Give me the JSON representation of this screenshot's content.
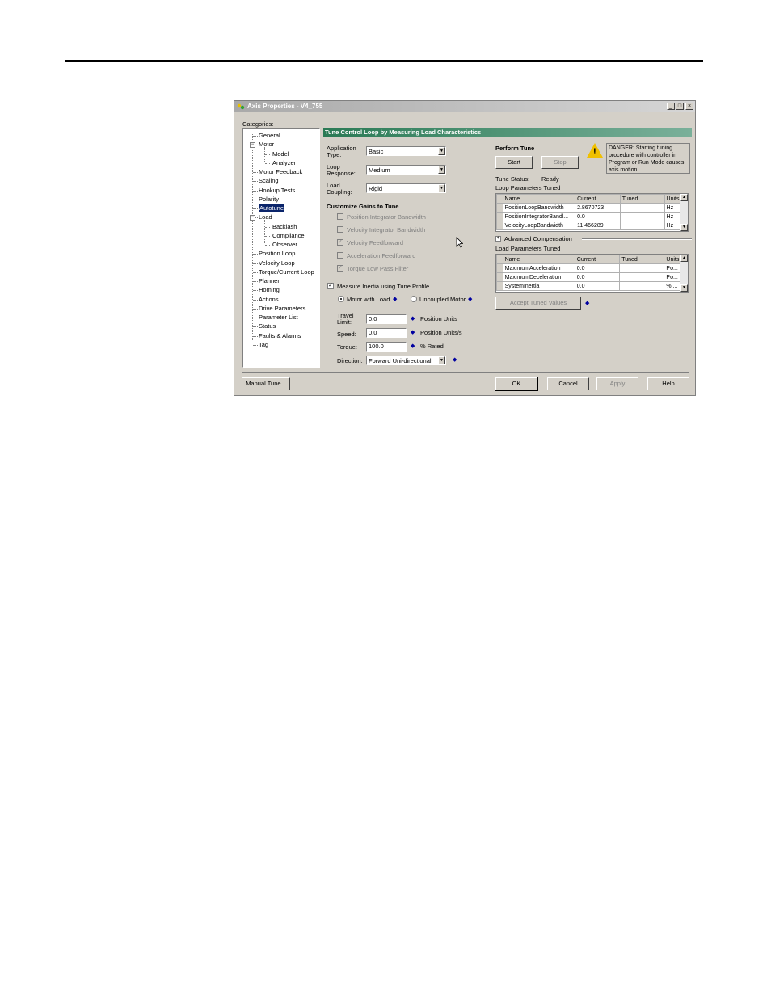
{
  "window": {
    "title": "Axis Properties - V4_755",
    "categories_label": "Categories:"
  },
  "tree": {
    "items": [
      {
        "label": "General",
        "level": 1
      },
      {
        "label": "Motor",
        "level": 1,
        "expander": "−"
      },
      {
        "label": "Model",
        "level": 2
      },
      {
        "label": "Analyzer",
        "level": 2
      },
      {
        "label": "Motor Feedback",
        "level": 1
      },
      {
        "label": "Scaling",
        "level": 1
      },
      {
        "label": "Hookup Tests",
        "level": 1
      },
      {
        "label": "Polarity",
        "level": 1
      },
      {
        "label": "Autotune",
        "level": 1,
        "selected": true
      },
      {
        "label": "Load",
        "level": 1,
        "expander": "−"
      },
      {
        "label": "Backlash",
        "level": 2
      },
      {
        "label": "Compliance",
        "level": 2
      },
      {
        "label": "Observer",
        "level": 2
      },
      {
        "label": "Position Loop",
        "level": 1
      },
      {
        "label": "Velocity Loop",
        "level": 1
      },
      {
        "label": "Torque/Current Loop",
        "level": 1
      },
      {
        "label": "Planner",
        "level": 1
      },
      {
        "label": "Homing",
        "level": 1
      },
      {
        "label": "Actions",
        "level": 1
      },
      {
        "label": "Drive Parameters",
        "level": 1
      },
      {
        "label": "Parameter List",
        "level": 1
      },
      {
        "label": "Status",
        "level": 1
      },
      {
        "label": "Faults & Alarms",
        "level": 1
      },
      {
        "label": "Tag",
        "level": 1
      }
    ]
  },
  "section_title": "Tune Control Loop by Measuring Load Characteristics",
  "left": {
    "application_type_label": "Application Type:",
    "application_type_value": "Basic",
    "loop_response_label": "Loop Response:",
    "loop_response_value": "Medium",
    "load_coupling_label": "Load Coupling:",
    "load_coupling_value": "Rigid",
    "customize_title": "Customize Gains to Tune",
    "gains": [
      {
        "label": "Position Integrator Bandwidth",
        "checked": false
      },
      {
        "label": "Velocity Integrator Bandwidth",
        "checked": false
      },
      {
        "label": "Velocity Feedforward",
        "checked": true
      },
      {
        "label": "Acceleration Feedforward",
        "checked": false
      },
      {
        "label": "Torque Low Pass Filter",
        "checked": true
      }
    ],
    "measure_inertia_label": "Measure Inertia using Tune Profile",
    "motor_with_load_label": "Motor with Load",
    "uncoupled_motor_label": "Uncoupled Motor",
    "travel_limit_label": "Travel Limit:",
    "travel_limit_value": "0.0",
    "travel_limit_units": "Position Units",
    "speed_label": "Speed:",
    "speed_value": "0.0",
    "speed_units": "Position Units/s",
    "torque_label": "Torque:",
    "torque_value": "100.0",
    "torque_units": "% Rated",
    "direction_label": "Direction:",
    "direction_value": "Forward Uni-directional"
  },
  "right": {
    "perform_tune_label": "Perform Tune",
    "start_label": "Start",
    "stop_label": "Stop",
    "danger_text": "DANGER: Starting tuning procedure with controller in Program or Run Mode causes axis motion.",
    "tune_status_label": "Tune Status:",
    "tune_status_value": "Ready",
    "loop_params_label": "Loop Parameters Tuned",
    "grid_headers": [
      "Name",
      "Current",
      "Tuned",
      "Units"
    ],
    "loop_rows": [
      [
        "PositionLoopBandwidth",
        "2.8670723",
        "",
        "Hz"
      ],
      [
        "PositionIntegratorBandl...",
        "0.0",
        "",
        "Hz"
      ],
      [
        "VelocityLoopBandwidth",
        "11.466289",
        "",
        "Hz"
      ]
    ],
    "advanced_comp_label": "Advanced Compensation",
    "load_params_label": "Load Parameters Tuned",
    "load_rows": [
      [
        "MaximumAcceleration",
        "0.0",
        "",
        "Po..."
      ],
      [
        "MaximumDeceleration",
        "0.0",
        "",
        "Po..."
      ],
      [
        "SystemInertia",
        "0.0",
        "",
        "% ..."
      ]
    ],
    "accept_label": "Accept Tuned Values"
  },
  "footer": {
    "manual_tune_label": "Manual Tune...",
    "ok_label": "OK",
    "cancel_label": "Cancel",
    "apply_label": "Apply",
    "help_label": "Help"
  }
}
